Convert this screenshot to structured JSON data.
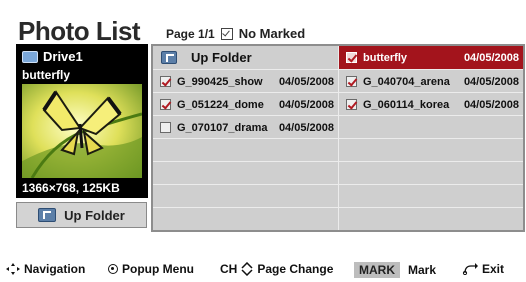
{
  "header": {
    "title": "Photo List",
    "page_label": "Page 1/1",
    "marked_label": "No Marked"
  },
  "preview": {
    "drive_label": "Drive1",
    "file_name": "butterfly",
    "resolution_info": "1366×768, 125KB",
    "up_folder_label": "Up Folder"
  },
  "grid": {
    "up_folder_label": "Up Folder",
    "items": [
      {
        "name": "butterfly",
        "date": "04/05/2008",
        "checked": true,
        "selected": true
      },
      {
        "name": "G_990425_show",
        "date": "04/05/2008",
        "checked": true,
        "selected": false
      },
      {
        "name": "G_040704_arena",
        "date": "04/05/2008",
        "checked": true,
        "selected": false
      },
      {
        "name": "G_051224_dome",
        "date": "04/05/2008",
        "checked": true,
        "selected": false
      },
      {
        "name": "G_060114_korea",
        "date": "04/05/2008",
        "checked": true,
        "selected": false
      },
      {
        "name": "G_070107_drama",
        "date": "04/05/2008",
        "checked": false,
        "selected": false
      }
    ]
  },
  "footer": {
    "navigation_label": "Navigation",
    "popup_label": "Popup Menu",
    "ch_label": "CH",
    "page_change_label": "Page Change",
    "mark_key": "MARK",
    "mark_label": "Mark",
    "exit_label": "Exit"
  },
  "colors": {
    "selected_row": "#a3141c",
    "grid_bg": "#cfcfcf",
    "preview_bg": "#000000"
  }
}
